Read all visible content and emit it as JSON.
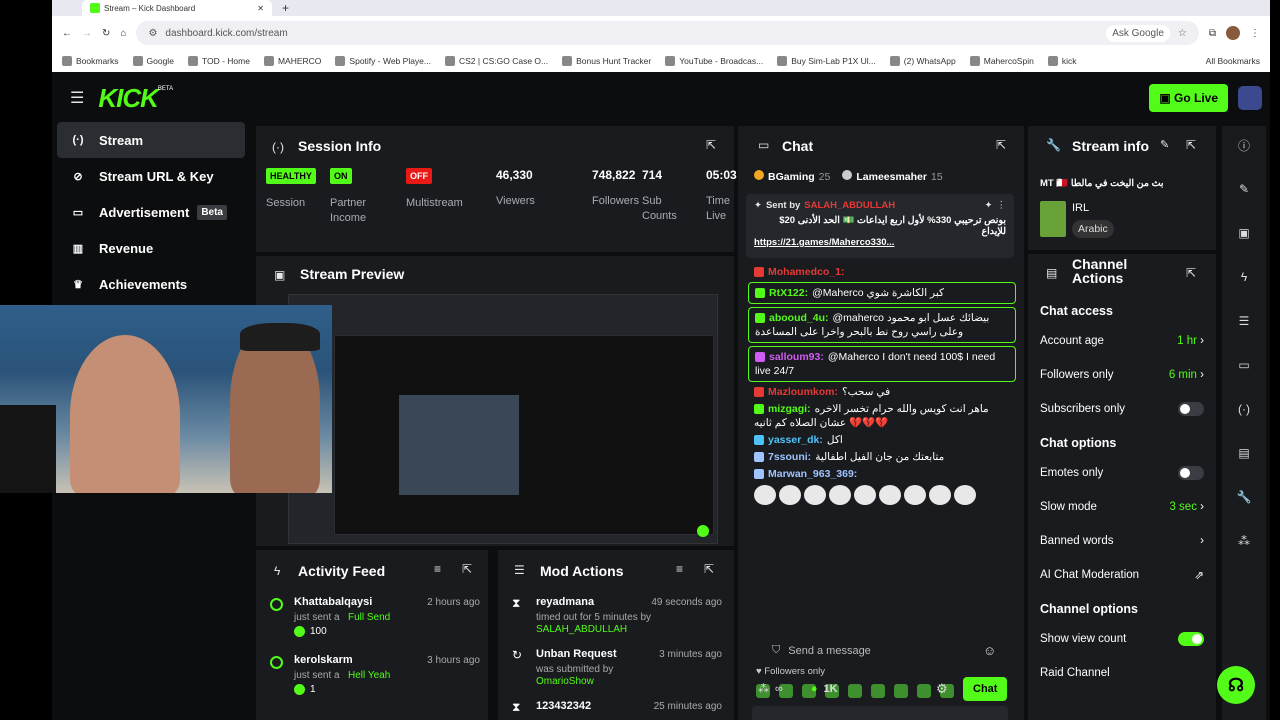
{
  "browser": {
    "tab_title": "Stream – Kick Dashboard",
    "url": "dashboard.kick.com/stream",
    "ask_google": "Ask Google",
    "bookmarks": [
      "Bookmarks",
      "Google",
      "TOD - Home",
      "MAHERCO",
      "Spotify - Web Playe...",
      "CS2 | CS:GO Case O...",
      "Bonus Hunt Tracker",
      "YouTube - Broadcas...",
      "Buy Sim-Lab P1X Ul...",
      "(2) WhatsApp",
      "MahercoSpin",
      "kick"
    ],
    "all_bookmarks": "All Bookmarks"
  },
  "header": {
    "logo": "KICK",
    "logo_badge": "BETA",
    "go_live": "Go Live"
  },
  "sidebar": {
    "items": [
      {
        "label": "Stream",
        "icon": "broadcast-icon"
      },
      {
        "label": "Stream URL & Key",
        "icon": "link-icon"
      },
      {
        "label": "Advertisement",
        "icon": "ad-icon",
        "badge": "Beta"
      },
      {
        "label": "Revenue",
        "icon": "chart-icon"
      },
      {
        "label": "Achievements",
        "icon": "trophy-icon"
      }
    ]
  },
  "session": {
    "title": "Session Info",
    "stats": [
      {
        "pill": "HEALTHY",
        "label": "Session",
        "color": "#53fc18"
      },
      {
        "pill": "ON",
        "label": "Partner\nIncome",
        "color": "#53fc18"
      },
      {
        "pill": "OFF",
        "label": "Multistream",
        "color": "#e91916"
      },
      {
        "value": "46,330",
        "label": "Viewers"
      },
      {
        "value": "748,822",
        "label": "Followers"
      },
      {
        "value": "714",
        "label": "Sub\nCounts"
      },
      {
        "value": "05:03",
        "label": "Time\nLive"
      }
    ]
  },
  "preview": {
    "title": "Stream Preview"
  },
  "activity": {
    "title": "Activity Feed",
    "items": [
      {
        "user": "Khattabalqaysi",
        "time": "2 hours ago",
        "text": "just sent a",
        "gift": "Full Send",
        "amount": "100"
      },
      {
        "user": "kerolskarm",
        "time": "3 hours ago",
        "text": "just sent a",
        "gift": "Hell Yeah",
        "amount": "1"
      }
    ]
  },
  "modactions": {
    "title": "Mod Actions",
    "items": [
      {
        "user": "reyadmana",
        "time": "49 seconds ago",
        "text": "timed out for 5 minutes by",
        "target": "SALAH_ABDULLAH"
      },
      {
        "user": "Unban Request",
        "time": "3 minutes ago",
        "text": "was submitted by",
        "target": "OmarioShow"
      },
      {
        "user": "123432342",
        "time": "25 minutes ago"
      }
    ]
  },
  "chat": {
    "title": "Chat",
    "leaderboard": [
      {
        "name": "BGaming",
        "count": "25"
      },
      {
        "name": "Lameesmaher",
        "count": "15"
      }
    ],
    "pinned": {
      "label": "Sent by",
      "user": "SALAH_ABDULLAH",
      "text": "بونص ترحيبي 330% لأول اربع ايداعات 💵 الحد الأدنى 20$ للإيداع",
      "link": "https://21.games/Maherco330..."
    },
    "messages": [
      {
        "user": "Mohamedco_1:",
        "color": "#e53935",
        "text": ""
      },
      {
        "user": "RtX122:",
        "color": "#53fc18",
        "text": "@Maherco كبر الكاشرة شوي",
        "box": true
      },
      {
        "user": "abooud_4u:",
        "color": "#53fc18",
        "text": "@maherco بيضائك عسل ابو محمود وعلى راسي روح نط بالبحر واخرا على المساعدة",
        "box": true
      },
      {
        "user": "salloum93:",
        "color": "#d15cf5",
        "text": "@Maherco I don't need 100$ I need live 24/7",
        "box": true
      },
      {
        "user": "Mazloumkom:",
        "color": "#e53935",
        "text": "في سحب؟"
      },
      {
        "user": "mizgagi:",
        "color": "#53fc18",
        "text": "ماهر انت كويس والله حرام تخسر الاخره عشان الصلاه كم ثانيه 💔💔💔"
      },
      {
        "user": "yasser_dk:",
        "color": "#4fc3f7",
        "text": "اكل"
      },
      {
        "user": "7ssouni:",
        "color": "#a0c4ff",
        "text": "متابعتك من جان الفيل اطفالية"
      },
      {
        "user": "Marwan_963_369:",
        "color": "#a0c4ff",
        "text": ""
      }
    ],
    "followers_only": "Followers only",
    "input_placeholder": "Send a message",
    "viewers": "1K",
    "send": "Chat"
  },
  "streaminfo": {
    "title": "Stream info",
    "stream_title": "بث من اليخت في مالطا MT 🇲🇹",
    "category": "IRL",
    "tag": "Arabic"
  },
  "channel": {
    "title": "Channel\nActions",
    "chat_access": "Chat access",
    "account_age": {
      "label": "Account age",
      "value": "1 hr"
    },
    "followers_only": {
      "label": "Followers only",
      "value": "6 min"
    },
    "subscribers_only": {
      "label": "Subscribers only"
    },
    "chat_options": "Chat options",
    "emotes_only": {
      "label": "Emotes only"
    },
    "slow_mode": {
      "label": "Slow mode",
      "value": "3 sec"
    },
    "banned_words": {
      "label": "Banned words"
    },
    "ai_mod": {
      "label": "AI Chat Moderation"
    },
    "channel_options": "Channel options",
    "show_view_count": {
      "label": "Show view count"
    },
    "raid": {
      "label": "Raid Channel"
    }
  }
}
